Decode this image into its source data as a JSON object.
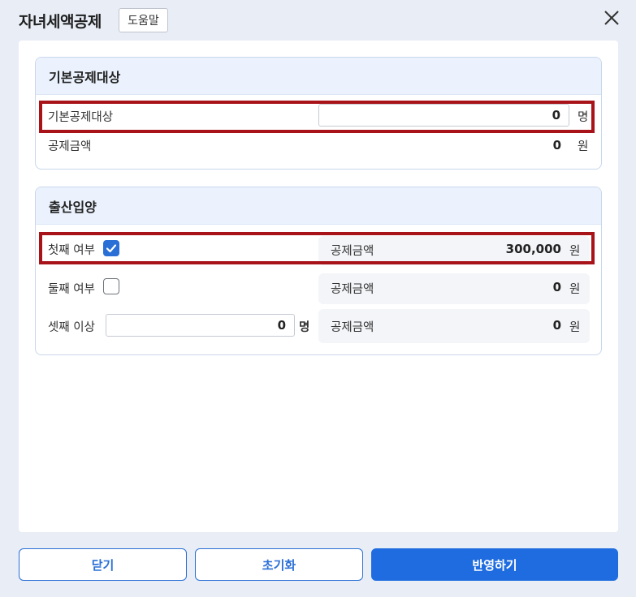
{
  "header": {
    "title": "자녀세액공제",
    "help_label": "도움말"
  },
  "basic_section": {
    "title": "기본공제대상",
    "dependents_label": "기본공제대상",
    "dependents_value": "0",
    "dependents_unit": "명",
    "deduction_label": "공제금액",
    "deduction_value": "0",
    "deduction_unit": "원"
  },
  "birth_section": {
    "title": "출산입양",
    "rows": [
      {
        "label": "첫째 여부",
        "checked": true,
        "deduction_label": "공제금액",
        "deduction_value": "300,000",
        "unit": "원"
      },
      {
        "label": "둘째 여부",
        "checked": false,
        "deduction_label": "공제금액",
        "deduction_value": "0",
        "unit": "원"
      },
      {
        "label": "셋째 이상",
        "input_value": "0",
        "input_unit": "명",
        "deduction_label": "공제금액",
        "deduction_value": "0",
        "unit": "원"
      }
    ]
  },
  "footer": {
    "close_label": "닫기",
    "reset_label": "초기화",
    "apply_label": "반영하기"
  },
  "colors": {
    "accent": "#1f6ce0",
    "highlight": "#a8131a",
    "section_header_bg": "#ebf2fd"
  }
}
